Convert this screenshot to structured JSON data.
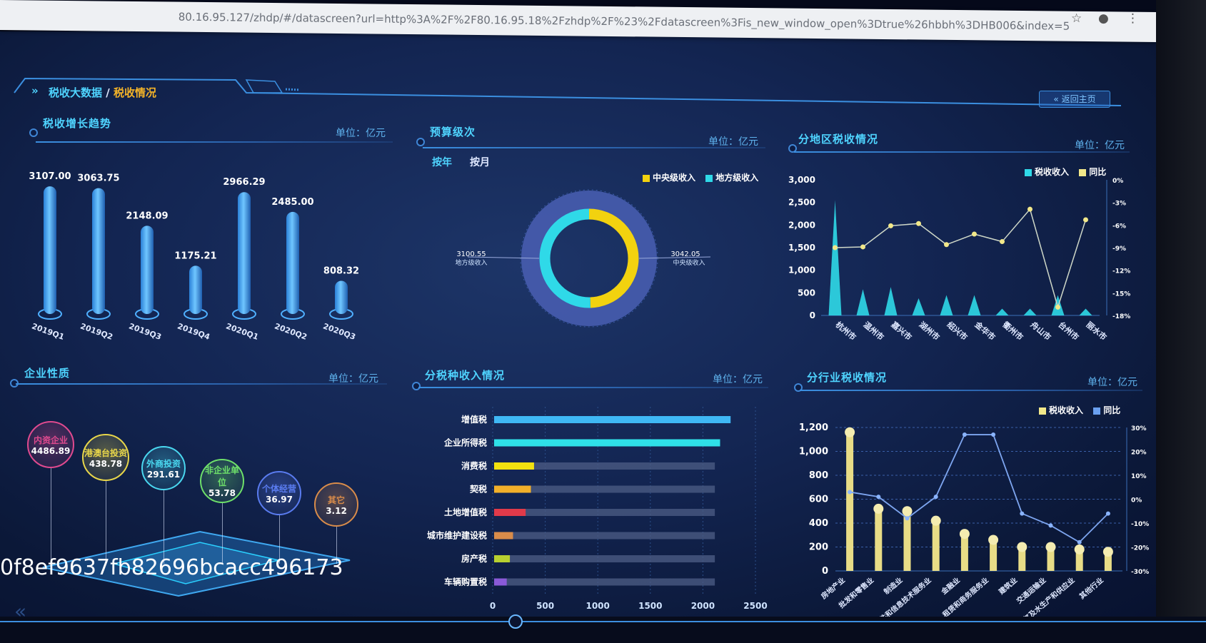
{
  "browser": {
    "url": "80.16.95.127/zhdp/#/datascreen?url=http%3A%2F%2F80.16.95.18%2Fzhdp%2F%23%2Fdatascreen%3Fis_new_window_open%3Dtrue%26hbbh%3DHB006&index=5"
  },
  "header": {
    "crumb_root": "税收大数据",
    "crumb_sep": " / ",
    "crumb_current": "税收情况",
    "back_button": "« 返回主页"
  },
  "growth": {
    "title": "税收增长趋势",
    "unit": "单位：亿元",
    "chart_data": {
      "type": "bar",
      "categories": [
        "2019Q1",
        "2019Q2",
        "2019Q3",
        "2019Q4",
        "2020Q1",
        "2020Q2",
        "2020Q3"
      ],
      "values": [
        3107.0,
        3063.75,
        2148.09,
        1175.21,
        2966.29,
        2485.0,
        808.32
      ],
      "labels": [
        "3107.00",
        "3063.75",
        "2148.09",
        "1175.21",
        "2966.29",
        "2485.00",
        "808.32"
      ],
      "ylim": [
        0,
        3300
      ]
    }
  },
  "budget": {
    "title": "预算级次",
    "unit": "单位：亿元",
    "tab_year": "按年",
    "tab_month": "按月",
    "chart_data": {
      "type": "pie",
      "slices": [
        {
          "name": "中央级收入",
          "value": 3042.05,
          "label": "3042.05",
          "color": "#f2d20f"
        },
        {
          "name": "地方级收入",
          "value": 3100.55,
          "label": "3100.55",
          "color": "#2fd9e8"
        }
      ]
    }
  },
  "region": {
    "title": "分地区税收情况",
    "unit": "单位：亿元",
    "legend_a": "税收收入",
    "legend_b": "同比",
    "chart_data": {
      "type": "bar",
      "categories": [
        "杭州市",
        "温州市",
        "嘉兴市",
        "湖州市",
        "绍兴市",
        "金华市",
        "衢州市",
        "舟山市",
        "台州市",
        "丽水市"
      ],
      "series": [
        {
          "name": "税收收入",
          "values": [
            2550,
            580,
            630,
            380,
            450,
            450,
            150,
            150,
            450,
            150
          ]
        },
        {
          "name": "同比",
          "values": [
            -9.0,
            -8.9,
            -6.1,
            -5.8,
            -8.6,
            -7.2,
            -8.2,
            -3.9,
            -16.9,
            -5.3
          ]
        }
      ],
      "ylim": [
        0,
        3000
      ],
      "y2lim": [
        -18,
        0
      ],
      "yticks": [
        "0",
        "500",
        "1,000",
        "1,500",
        "2,000",
        "2,500",
        "3,000"
      ],
      "y2ticks": [
        "0%",
        "-3%",
        "-6%",
        "-9%",
        "-12%",
        "-15%",
        "-18%"
      ]
    }
  },
  "enterprise": {
    "title": "企业性质",
    "unit": "单位：亿元",
    "items": [
      {
        "name": "内资企业",
        "value": "4486.89",
        "color": "#e04a8f"
      },
      {
        "name": "港澳台投资",
        "value": "438.78",
        "color": "#e8d64a"
      },
      {
        "name": "外商投资",
        "value": "291.61",
        "color": "#4ad8f0"
      },
      {
        "name": "非企业单位",
        "value": "53.78",
        "color": "#6ee06a"
      },
      {
        "name": "个体经营",
        "value": "36.97",
        "color": "#5a7cf0"
      },
      {
        "name": "其它",
        "value": "3.12",
        "color": "#d98c4a"
      }
    ]
  },
  "taxtype": {
    "title": "分税种收入情况",
    "unit": "单位：亿元",
    "chart_data": {
      "type": "bar",
      "categories": [
        "增值税",
        "企业所得税",
        "消费税",
        "契税",
        "土地增值税",
        "城市维护建设税",
        "房产税",
        "车辆购置税"
      ],
      "values": [
        2250,
        2150,
        380,
        350,
        300,
        180,
        150,
        120
      ],
      "colors": [
        "#3fb8f5",
        "#2fe0e8",
        "#f2e20f",
        "#f2b02a",
        "#e03a4a",
        "#d98c4a",
        "#b8d030",
        "#8a5ad8"
      ],
      "xlim": [
        0,
        2500
      ],
      "xticks": [
        "0",
        "500",
        "1000",
        "1500",
        "2000",
        "2500"
      ]
    }
  },
  "industry": {
    "title": "分行业税收情况",
    "unit": "单位：亿元",
    "legend_a": "税收收入",
    "legend_b": "同比",
    "chart_data": {
      "type": "bar",
      "categories": [
        "房地产业",
        "批发和零售业",
        "制造业",
        "信息传输、软件和信息技术服务业",
        "金融业",
        "租赁和商务服务业",
        "建筑业",
        "交通运输业",
        "电力、热力、燃气及水生产和供应业",
        "其他行业"
      ],
      "series": [
        {
          "name": "税收收入",
          "values": [
            1160,
            520,
            500,
            420,
            310,
            260,
            200,
            200,
            180,
            160
          ]
        },
        {
          "name": "同比",
          "values": [
            3.0,
            1.0,
            -8.0,
            1.0,
            27.0,
            27.0,
            -6.0,
            -11.0,
            -18.0,
            -6.0
          ]
        }
      ],
      "ylim": [
        0,
        1200
      ],
      "y2lim": [
        -30,
        30
      ],
      "yticks": [
        "0",
        "200",
        "400",
        "600",
        "800",
        "1,000",
        "1,200"
      ],
      "y2ticks": [
        "-30%",
        "-20%",
        "-10%",
        "0%",
        "10%",
        "20%",
        "30%"
      ]
    }
  },
  "overlay": {
    "hash_text": "0f8ef9637fb82696bcacc496173"
  }
}
